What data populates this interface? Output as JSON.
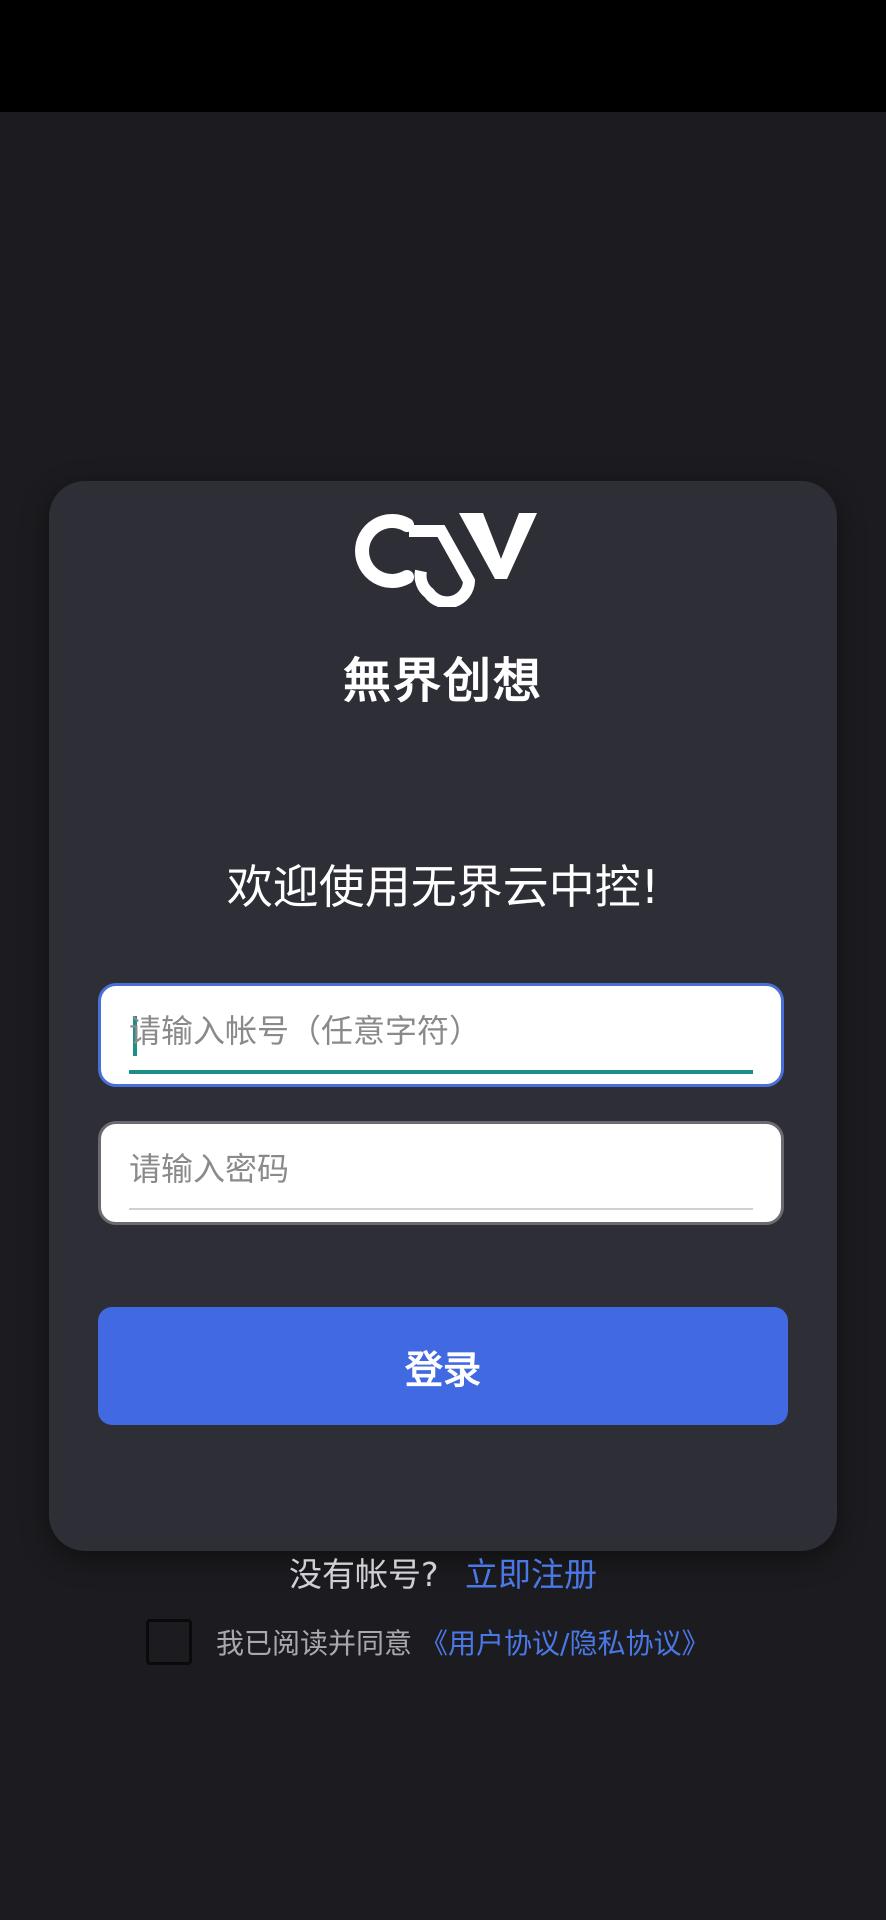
{
  "brand": {
    "logo_text": "無界创想",
    "logo_mark_icon": "cw-logo-icon"
  },
  "login": {
    "welcome": "欢迎使用无界云中控!",
    "account_placeholder": "请输入帐号（任意字符）",
    "account_value": "",
    "password_placeholder": "请输入密码",
    "password_value": "",
    "submit_label": "登录"
  },
  "register": {
    "question": "没有帐号?",
    "link": "立即注册"
  },
  "agreement": {
    "checked": false,
    "text": "我已阅读并同意",
    "link": "《用户协议/隐私协议》"
  },
  "colors": {
    "background": "#1c1c20",
    "card": "#2d2e36",
    "accent": "#4169e1",
    "link": "#4a78e6",
    "focus_underline": "#1e8f84"
  }
}
